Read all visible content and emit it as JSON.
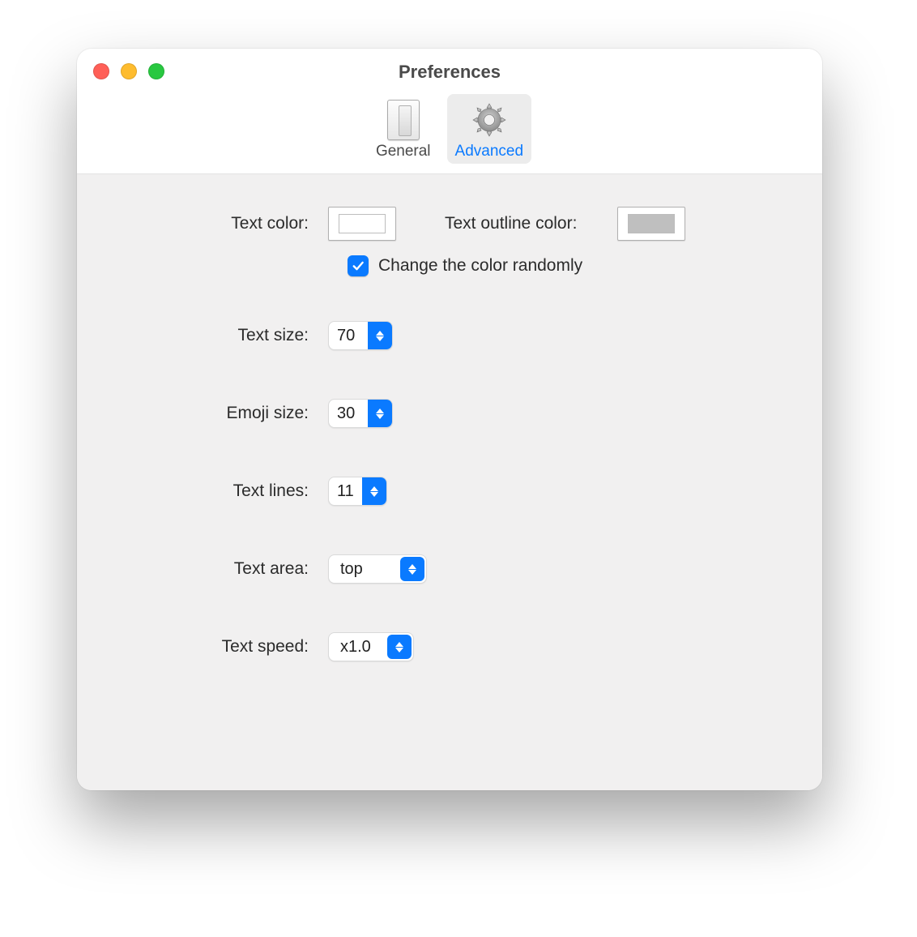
{
  "window": {
    "title": "Preferences"
  },
  "tabs": {
    "general": "General",
    "advanced": "Advanced",
    "selected": "advanced"
  },
  "labels": {
    "text_color": "Text color:",
    "text_outline_color": "Text outline color:",
    "random_color": "Change the color randomly",
    "text_size": "Text size:",
    "emoji_size": "Emoji size:",
    "text_lines": "Text lines:",
    "text_area": "Text area:",
    "text_speed": "Text speed:"
  },
  "values": {
    "text_color": "#ffffff",
    "text_outline_color": "#bfbfbf",
    "random_color_checked": true,
    "text_size": "70",
    "emoji_size": "30",
    "text_lines": "11",
    "text_area": "top",
    "text_speed": "x1.0"
  }
}
